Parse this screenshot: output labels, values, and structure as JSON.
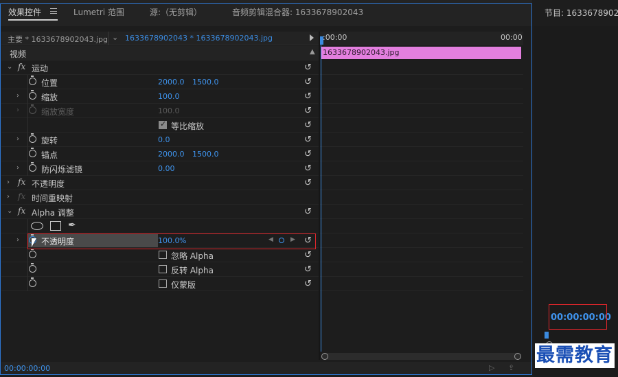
{
  "tabs": {
    "effect_controls": "效果控件",
    "lumetri": "Lumetri 范围",
    "source": "源:（无剪辑）",
    "audio_mixer": "音频剪辑混合器: 1633678902043"
  },
  "header": {
    "master": "主要 * 1633678902043.jpg",
    "clip": "1633678902043 * 1633678902043.jpg"
  },
  "timeline": {
    "start": ":00:00",
    "end": "00:00",
    "clip_name": "1633678902043.jpg"
  },
  "sections": {
    "video": "视频",
    "motion": "运动",
    "opacity_fx": "不透明度",
    "time_remap": "时间重映射",
    "alpha_adjust": "Alpha 调整"
  },
  "props": {
    "position": {
      "label": "位置",
      "x": "2000.0",
      "y": "1500.0"
    },
    "scale": {
      "label": "缩放",
      "value": "100.0"
    },
    "scale_width": {
      "label": "缩放宽度",
      "value": "100.0"
    },
    "uniform_scale": {
      "label": "等比缩放"
    },
    "rotation": {
      "label": "旋转",
      "value": "0.0"
    },
    "anchor": {
      "label": "锚点",
      "x": "2000.0",
      "y": "1500.0"
    },
    "flicker": {
      "label": "防闪烁滤镜",
      "value": "0.00"
    },
    "opacity": {
      "label": "不透明度",
      "value": "100.0",
      "unit": "%"
    },
    "ignore_alpha": {
      "label": "忽略 Alpha"
    },
    "invert_alpha": {
      "label": "反转 Alpha"
    },
    "mask_only": {
      "label": "仅蒙版"
    }
  },
  "icons": {
    "fx": "fx",
    "reset": "↺",
    "pen": "✒",
    "expand": "›",
    "collapse": "⌄"
  },
  "bottom": {
    "time": "00:00:00:00"
  },
  "program": {
    "title": "节目: 1633678902043",
    "time": "00:00:00:00"
  },
  "watermark": "最需教育",
  "colors": {
    "accent": "#3f94ee",
    "clip": "#e37fdf",
    "highlight_box": "#e0262b"
  }
}
